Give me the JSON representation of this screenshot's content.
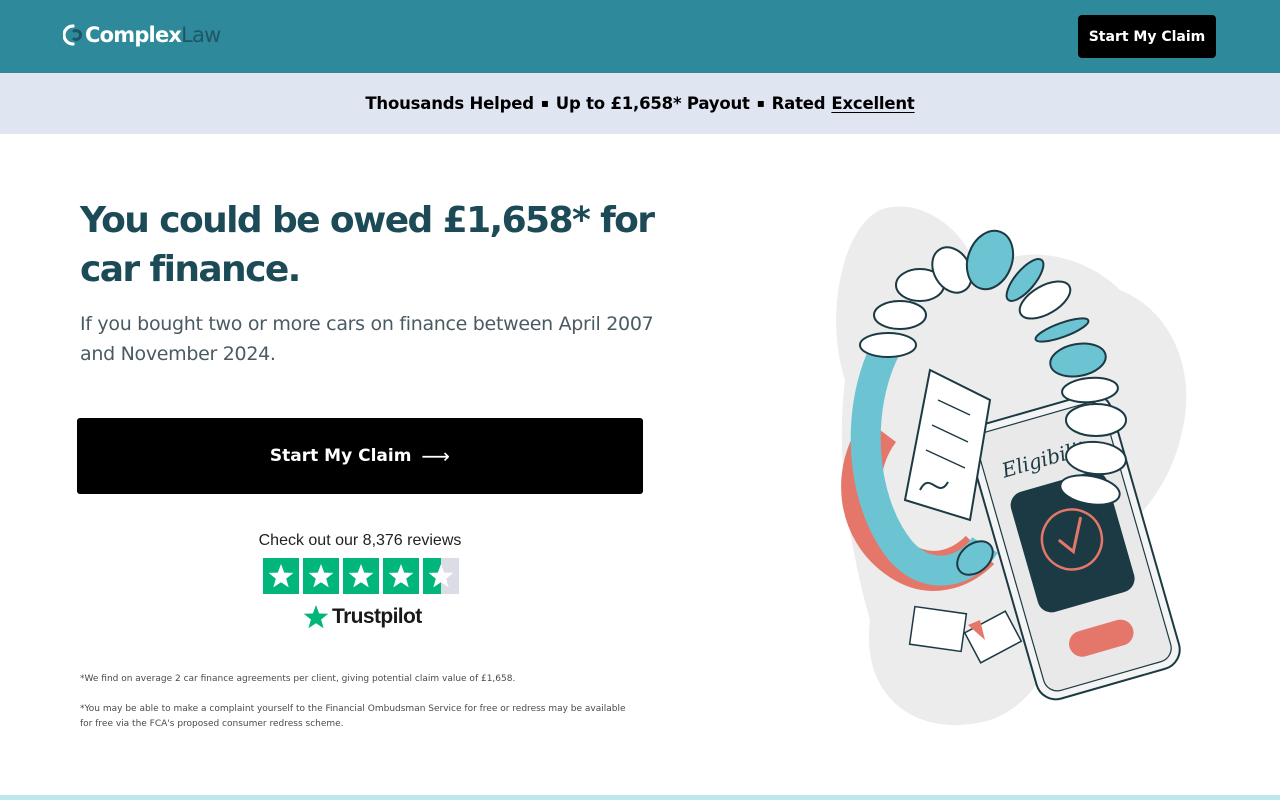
{
  "header": {
    "logo_part1": "Complex",
    "logo_part2": "Law",
    "cta_label": "Start My Claim"
  },
  "banner": {
    "item1": "Thousands Helped",
    "separator": "▪",
    "item2": "Up to £1,658* Payout",
    "item3_prefix": "Rated",
    "item3_link": "Excellent"
  },
  "hero": {
    "headline": "You could be owed £1,658* for car finance.",
    "subhead": "If you bought two or more cars on finance between April 2007 and November 2024.",
    "cta_label": "Start My Claim",
    "cta_arrow": "⟶"
  },
  "reviews": {
    "text": "Check out our 8,376 reviews",
    "rating_stars": 4.5,
    "brand": "Trustpilot"
  },
  "footnotes": {
    "note1": "*We find on average 2 car finance agreements per client, giving potential claim value of £1,658.",
    "note2": "*You may be able to make a complaint yourself to the Financial Ombudsman Service for free or redress may be available for free via the FCA's proposed consumer redress scheme."
  },
  "illustration": {
    "phone_text": "Eligibility"
  },
  "colors": {
    "brand_teal": "#2e8a9a",
    "banner_bg": "#dfe5f1",
    "headline": "#1c4a57",
    "trustpilot_green": "#00b67a",
    "coin_blue": "#6cc4d3",
    "accent_coral": "#e4776a"
  }
}
